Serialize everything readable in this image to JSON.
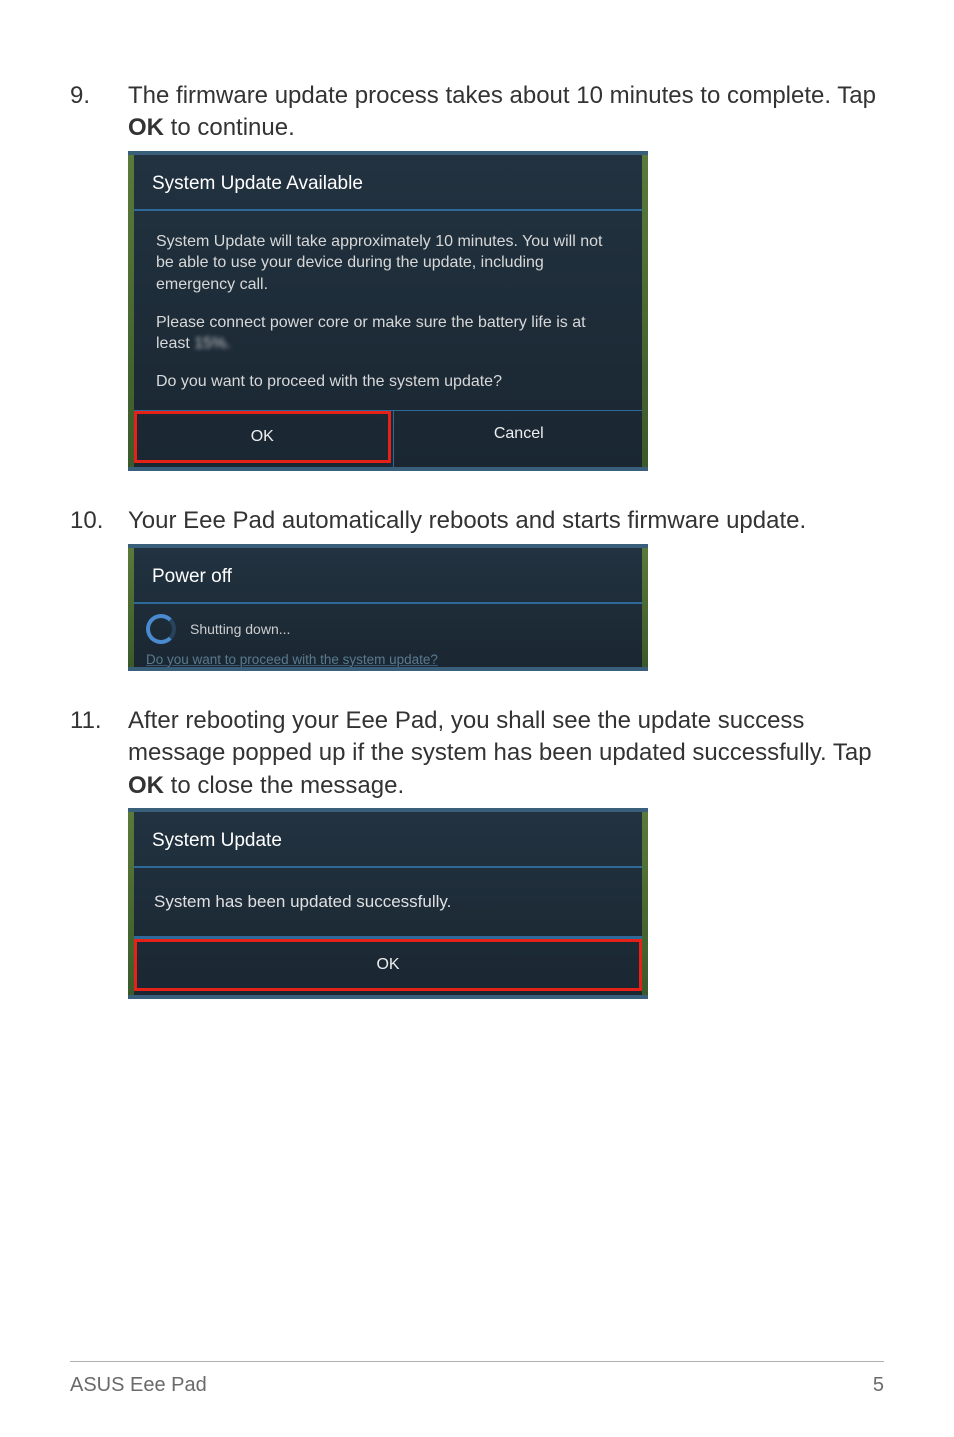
{
  "steps": {
    "s9": {
      "num": "9.",
      "text_before": "The firmware update process takes about 10 minutes to complete. Tap ",
      "bold": "OK",
      "text_after": " to continue."
    },
    "s10": {
      "num": "10.",
      "text": "Your Eee Pad automatically reboots and starts firmware update."
    },
    "s11": {
      "num": "11.",
      "text_before": "After rebooting your Eee Pad, you shall see the update success message popped up if the system has been updated successfully. Tap ",
      "bold": "OK",
      "text_after": " to close the message."
    }
  },
  "dialog1": {
    "title": "System Update Available",
    "para1": "System Update will take approximately 10 minutes. You will not be able to use your device during the update, including emergency call.",
    "para2_before": "Please connect power core or make sure the battery life is at least ",
    "para2_blur": "15%.",
    "para3": "Do you want to proceed with the system update?",
    "ok": "OK",
    "cancel": "Cancel"
  },
  "dialog2": {
    "title": "Power off",
    "status": "Shutting down...",
    "cutline": "Do you want to proceed with the system update?"
  },
  "dialog3": {
    "title": "System Update",
    "msg": "System has been updated successfully.",
    "ok": "OK"
  },
  "footer": {
    "left": "ASUS Eee Pad",
    "right": "5"
  }
}
